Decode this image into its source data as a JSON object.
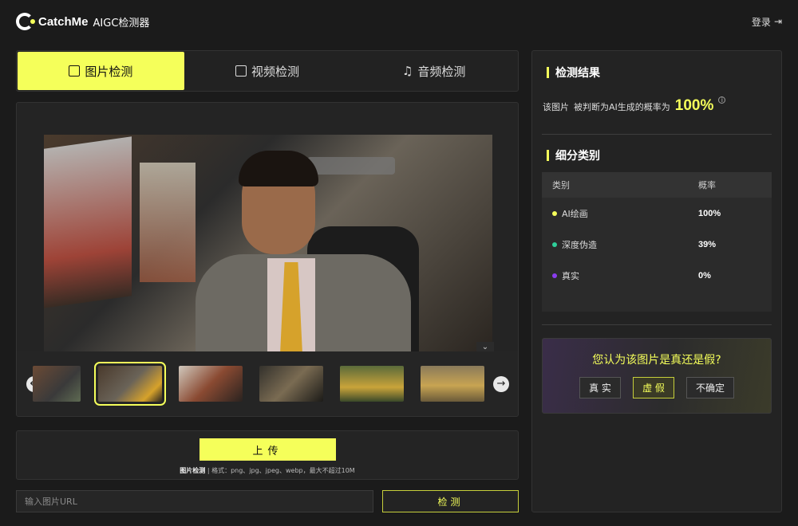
{
  "header": {
    "brand": "CatchMe",
    "subtitle": "AIGC检测器",
    "login": "登录"
  },
  "tabs": [
    {
      "label": "图片检测",
      "icon": "image-icon",
      "active": true
    },
    {
      "label": "视频检测",
      "icon": "video-icon",
      "active": false
    },
    {
      "label": "音频检测",
      "icon": "music-icon",
      "active": false
    }
  ],
  "gallery": {
    "selected_index": 1,
    "thumbnail_count": 6
  },
  "upload": {
    "button_label": "上传",
    "note_label": "图片检测",
    "note_text": "格式：png、jpg、jpeg、webp，最大不超过10M"
  },
  "url": {
    "placeholder": "输入图片URL"
  },
  "detect": {
    "button_label": "检测"
  },
  "result": {
    "title": "检测结果",
    "subject": "该图片",
    "verdict_text": "被判断为AI生成的概率为",
    "probability": "100%"
  },
  "breakdown": {
    "title": "细分类别",
    "col_category": "类别",
    "col_prob": "概率",
    "rows": [
      {
        "label": "AI绘画",
        "value": "100%",
        "color": "#f5ff5a"
      },
      {
        "label": "深度伪造",
        "value": "39%",
        "color": "#2fcf9a"
      },
      {
        "label": "真实",
        "value": "0%",
        "color": "#8a3cf0"
      }
    ]
  },
  "vote": {
    "question": "您认为该图片是真还是假?",
    "real": "真 实",
    "fake": "虚 假",
    "unsure": "不确定"
  },
  "colors": {
    "accent": "#f5ff5a",
    "bg": "#1b1b1b",
    "panel": "#232323"
  }
}
